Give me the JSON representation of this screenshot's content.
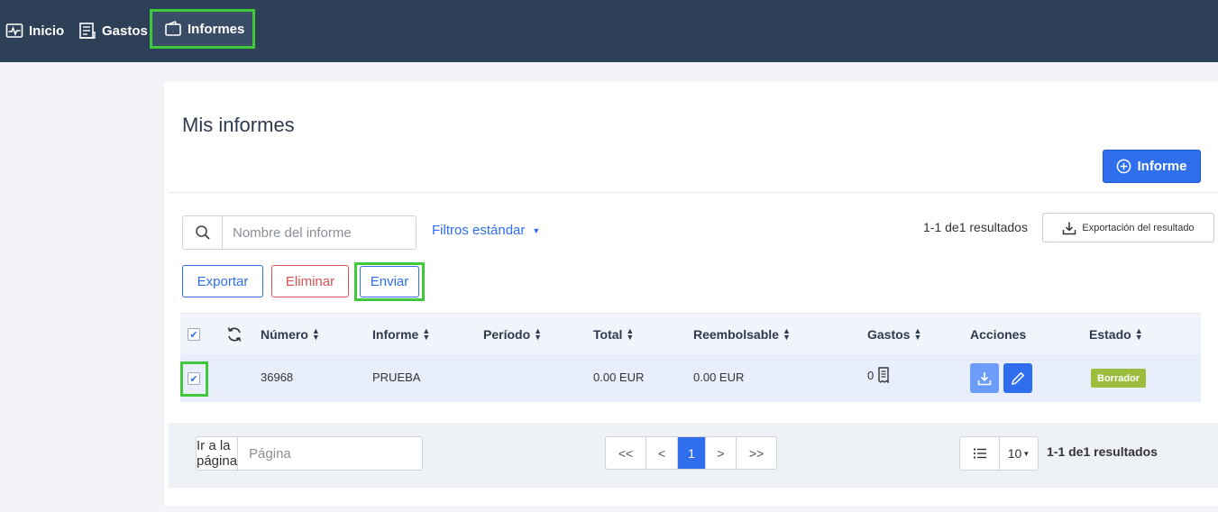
{
  "nav": {
    "inicio": "Inicio",
    "gastos": "Gastos",
    "informes": "Informes"
  },
  "page": {
    "title": "Mis informes",
    "new_button": "Informe"
  },
  "toolbar": {
    "search_placeholder": "Nombre del informe",
    "filters_label": "Filtros estándar",
    "results_count": "1-1 de1 resultados",
    "export_result_label": "Exportación del resultado",
    "exportar_label": "Exportar",
    "eliminar_label": "Eliminar",
    "enviar_label": "Enviar"
  },
  "table": {
    "headers": {
      "numero": "Número",
      "informe": "Informe",
      "periodo": "Período",
      "total": "Total",
      "reembolsable": "Reembolsable",
      "gastos": "Gastos",
      "acciones": "Acciones",
      "estado": "Estado"
    },
    "rows": [
      {
        "numero": "36968",
        "informe": "PRUEBA",
        "periodo": "",
        "total": "0.00 EUR",
        "reembolsable": "0.00 EUR",
        "gastos": "0",
        "estado": "Borrador"
      }
    ]
  },
  "pagination": {
    "goto_label": "Ir a la página",
    "goto_placeholder": "Página",
    "first": "<<",
    "prev": "<",
    "current": "1",
    "next": ">",
    "last": ">>",
    "per_page": "10",
    "results": "1-1 de1 resultados"
  },
  "colors": {
    "topbar": "#2e4057",
    "primary": "#2f6fee",
    "danger": "#d9534f",
    "badge_draft": "#9bbf3d",
    "highlight": "#3ec83a"
  }
}
